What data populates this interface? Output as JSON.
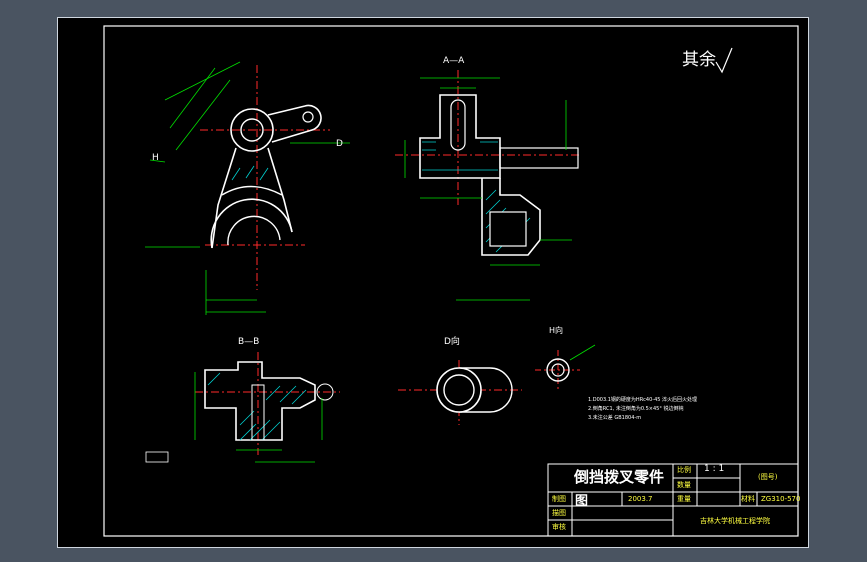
{
  "colors": {
    "background": "#4a5461",
    "sheet": "#000000",
    "outline": "#ffffff",
    "center_line": "#ff2a2a",
    "dimension": "#00e000",
    "hatch": "#00d0d0",
    "table": "#ffffff",
    "accent_yellow": "#ffff40",
    "note_blue": "#b0c0ff"
  },
  "views": {
    "section_aa": "A—A",
    "section_bb": "B—B",
    "view_d": "D向",
    "view_h": "H向",
    "roughness_note": "其余",
    "label_d": "D",
    "label_h": "H"
  },
  "notes": {
    "line1": "1.D003.1钢的硬度为HRc40-45 淬火后回火处理",
    "line2": "2.倒角RC1, 未注倒角为0.5×45° 锐边倒钝",
    "line3": "3.未注公差 GB1804-m"
  },
  "title_block": {
    "drawing_name": "倒挡拨叉零件",
    "drawing_name_2": "图",
    "ratio_label": "比例",
    "ratio_value": "1 : 1",
    "quantity_label": "数量",
    "drawing_no_placeholder": "(图号)",
    "drawn_label": "制图",
    "drawn_date": "2003.7",
    "material_label": "材料",
    "weight_label": "重量",
    "material_value": "ZG310-570",
    "design_label": "描图",
    "check_label": "审核",
    "school": "吉林大学机械工程学院"
  }
}
